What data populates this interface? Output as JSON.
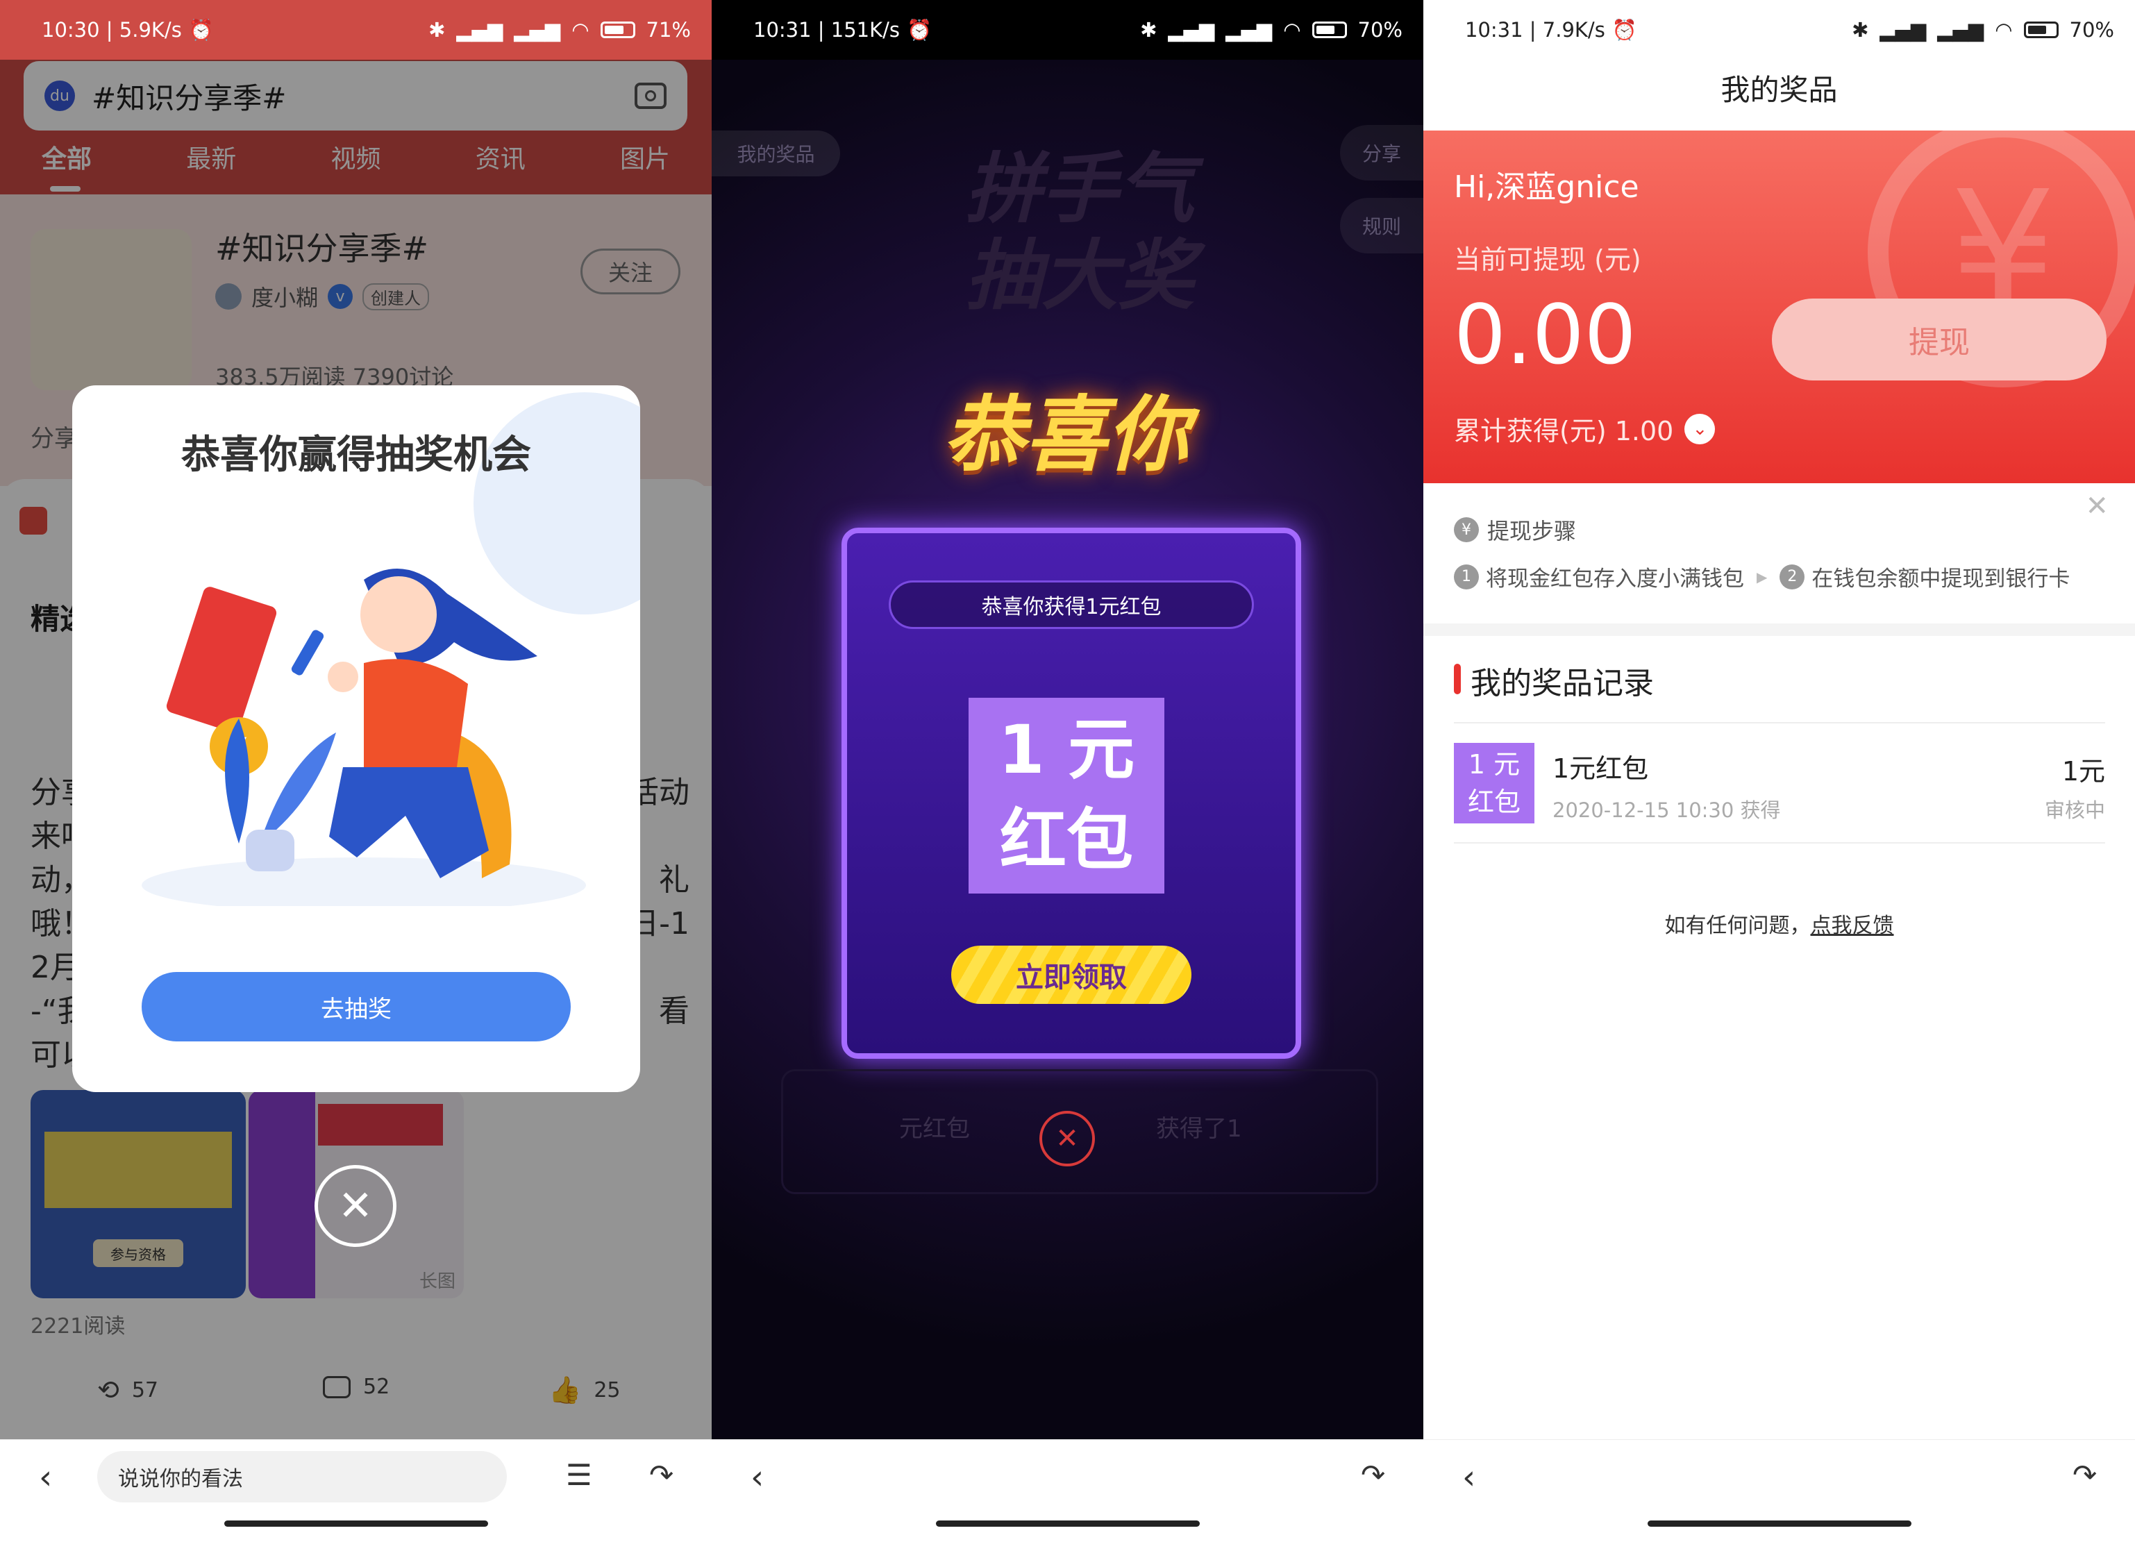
{
  "panel1": {
    "status": {
      "time": "10:30 | 5.9K/s",
      "battery": "71%",
      "battery_fill": 0.71
    },
    "search": {
      "text": "#知识分享季#"
    },
    "tabs": [
      "全部",
      "最新",
      "视频",
      "资讯",
      "图片"
    ],
    "topic": {
      "title": "#知识分享季#",
      "author": "度小糊",
      "badge": "创建人",
      "follow": "关注",
      "stats": "383.5万阅读  7390讨论",
      "share_frag": "分享"
    },
    "bg": {
      "section": "精选",
      "frag_left": [
        "分享",
        "来吗",
        "动，",
        "哦！",
        "2月",
        "-“我",
        "可以"
      ],
      "frag_right": [
        "活动",
        "礼",
        "日-1",
        "看"
      ],
      "read_count": "2221阅读",
      "poster_caption": "参与资格",
      "long_pic": "长图"
    },
    "actions": {
      "repost": "57",
      "comment": "52",
      "like": "25"
    },
    "bottom": {
      "input_placeholder": "说说你的看法"
    },
    "modal": {
      "title": "恭喜你赢得抽奖机会",
      "button": "去抽奖"
    }
  },
  "panel2": {
    "status": {
      "time": "10:31 | 151K/s",
      "battery": "70%",
      "battery_fill": 0.7
    },
    "corner": {
      "my_prizes": "我的奖品",
      "share": "分享",
      "rules": "规则"
    },
    "bg_title": [
      "拼手气",
      "抽大奖"
    ],
    "banner": "恭喜你",
    "card": {
      "subtitle": "恭喜你获得1元红包",
      "prize_line1": "1 元",
      "prize_line2": "红包",
      "claim": "立即领取"
    },
    "ticker": {
      "left": "元红包",
      "right": "获得了1"
    }
  },
  "panel3": {
    "status": {
      "time": "10:31 | 7.9K/s",
      "battery": "70%",
      "battery_fill": 0.7
    },
    "title": "我的奖品",
    "greeting": "Hi,深蓝gnice",
    "withdrawable_label": "当前可提现 (元)",
    "amount": "0.00",
    "withdraw_btn": "提现",
    "total": "累计获得(元) 1.00",
    "steps": {
      "title": "提现步骤",
      "step1": "将现金红包存入度小满钱包",
      "step2": "在钱包余额中提现到银行卡"
    },
    "records_title": "我的奖品记录",
    "record": {
      "thumb_line1": "1 元",
      "thumb_line2": "红包",
      "name": "1元红包",
      "time": "2020-12-15 10:30 获得",
      "amount": "1元",
      "status": "审核中"
    },
    "feedback": {
      "text": "如有任何问题，",
      "link": "点我反馈"
    }
  }
}
